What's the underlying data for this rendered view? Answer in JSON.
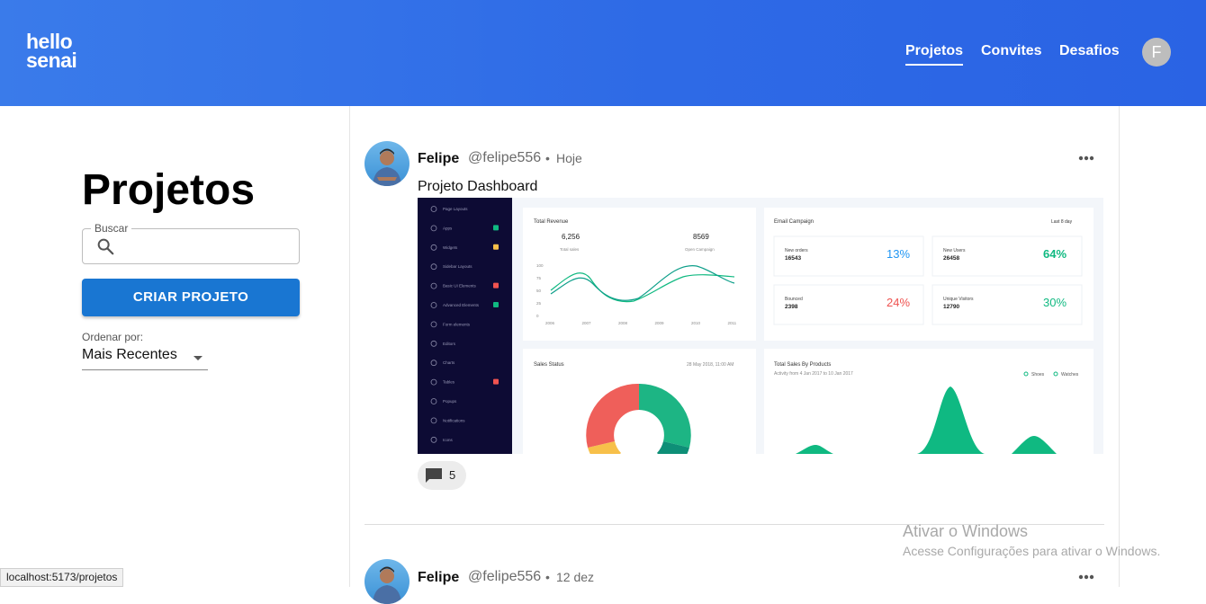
{
  "brand": {
    "line1": "hello",
    "line2": "senai"
  },
  "nav": {
    "projects": "Projetos",
    "invites": "Convites",
    "challenges": "Desafios"
  },
  "user": {
    "initial": "F"
  },
  "sidebar": {
    "title": "Projetos",
    "search_label": "Buscar",
    "search_value": "",
    "create_button": "CRIAR PROJETO",
    "order_label": "Ordenar por:",
    "order_value": "Mais Recentes"
  },
  "posts": [
    {
      "name": "Felipe",
      "handle": "@felipe556",
      "separator": "•",
      "date": "Hoje",
      "description": "Projeto Dashboard",
      "comments": "5"
    },
    {
      "name": "Felipe",
      "handle": "@felipe556",
      "separator": "•",
      "date": "12 dez"
    }
  ],
  "dashboard": {
    "menu": [
      "Page Layouts",
      "Apps",
      "Widgets",
      "Sidebar Layouts",
      "Basic UI Elements",
      "Advanced Elements",
      "Form elements",
      "Editors",
      "Charts",
      "Tables",
      "Popups",
      "Notifications",
      "Icons"
    ],
    "revenue": {
      "title": "Total Revenue",
      "sales_value": "6,256",
      "sales_label": "Total sales",
      "campaign_value": "8569",
      "campaign_label": "Open Campaign",
      "y_ticks": [
        "100",
        "75",
        "50",
        "25",
        "0"
      ],
      "x_ticks": [
        "2006",
        "2007",
        "2008",
        "2009",
        "2010",
        "2011"
      ]
    },
    "email": {
      "title": "Email Campaign",
      "range": "Last 8 day",
      "stats": [
        {
          "label": "New orders",
          "value": "16543",
          "pct": "13%"
        },
        {
          "label": "New Users",
          "value": "26458",
          "pct": "64%"
        },
        {
          "label": "Bounced",
          "value": "2398",
          "pct": "24%"
        },
        {
          "label": "Unique Visitors",
          "value": "12790",
          "pct": "30%"
        }
      ]
    },
    "sales_status": {
      "title": "Sales Status",
      "date": "28 May 2018, 11:00 AM"
    },
    "products": {
      "title": "Total Sales By Products",
      "subtitle": "Activity from 4 Jan 2017 to 10 Jan 2017",
      "legend1": "Shoes",
      "legend2": "Watches"
    }
  },
  "watermark": {
    "line1": "Ativar o Windows",
    "line2": "Acesse Configurações para ativar o Windows."
  },
  "status_bar": {
    "url": "localhost:5173/projetos"
  },
  "colors": {
    "header": "#2e6ae6",
    "button": "#1976d2",
    "dash_sidebar": "#0d0b34",
    "teal": "#10b981",
    "red": "#ef5350",
    "yellow": "#f7c04a",
    "blue": "#2196f3"
  }
}
